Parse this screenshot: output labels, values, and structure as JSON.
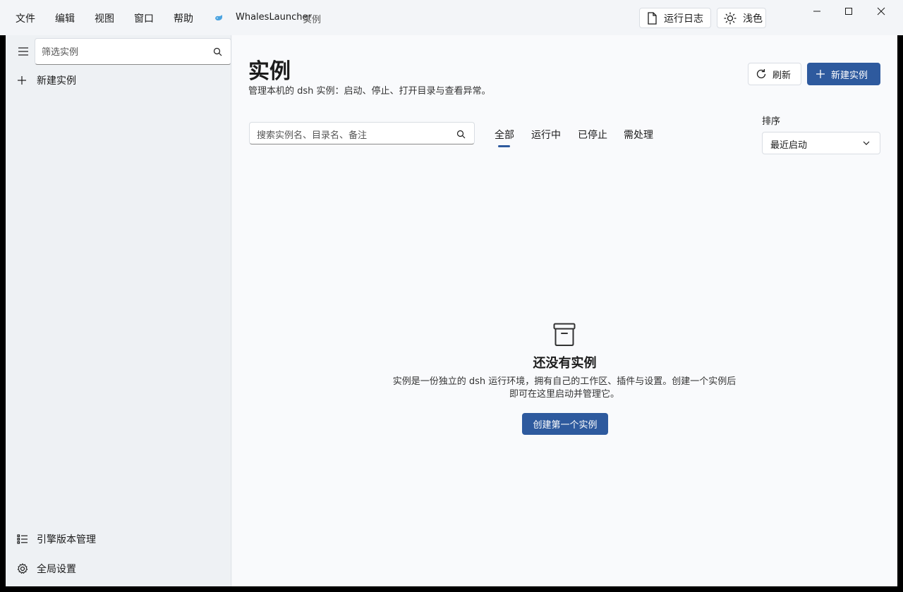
{
  "menu": [
    "文件",
    "编辑",
    "视图",
    "窗口",
    "帮助"
  ],
  "app": {
    "name": "WhalesLauncher",
    "section": "实例"
  },
  "titlebar": {
    "log_label": "运行日志",
    "theme_label": "浅色"
  },
  "window_controls": {
    "minimize_icon": "minimize-icon",
    "maximize_icon": "maximize-icon",
    "close_icon": "close-icon"
  },
  "sidebar": {
    "filter_placeholder": "筛选实例",
    "new_instance_label": "新建实例",
    "engine_label": "引擎版本管理",
    "settings_label": "全局设置"
  },
  "main": {
    "title": "实例",
    "subtitle": "管理本机的 dsh 实例：启动、停止、打开目录与查看异常。",
    "refresh_label": "刷新",
    "new_label": "新建实例",
    "search_placeholder": "搜索实例名、目录名、备注",
    "tabs": [
      "全部",
      "运行中",
      "已停止",
      "需处理"
    ],
    "active_tab": "全部",
    "sort_label": "排序",
    "sort_value": "最近启动",
    "empty_title": "还没有实例",
    "empty_desc": "实例是一份独立的 dsh 运行环境，拥有自己的工作区、插件与设置。创建一个实例后即可在这里启动并管理它。",
    "create_label": "创建第一个实例"
  },
  "colors": {
    "accent": "#2e5a9e",
    "sidebar_bg": "#eef1f4",
    "main_bg": "#f9fafc"
  }
}
